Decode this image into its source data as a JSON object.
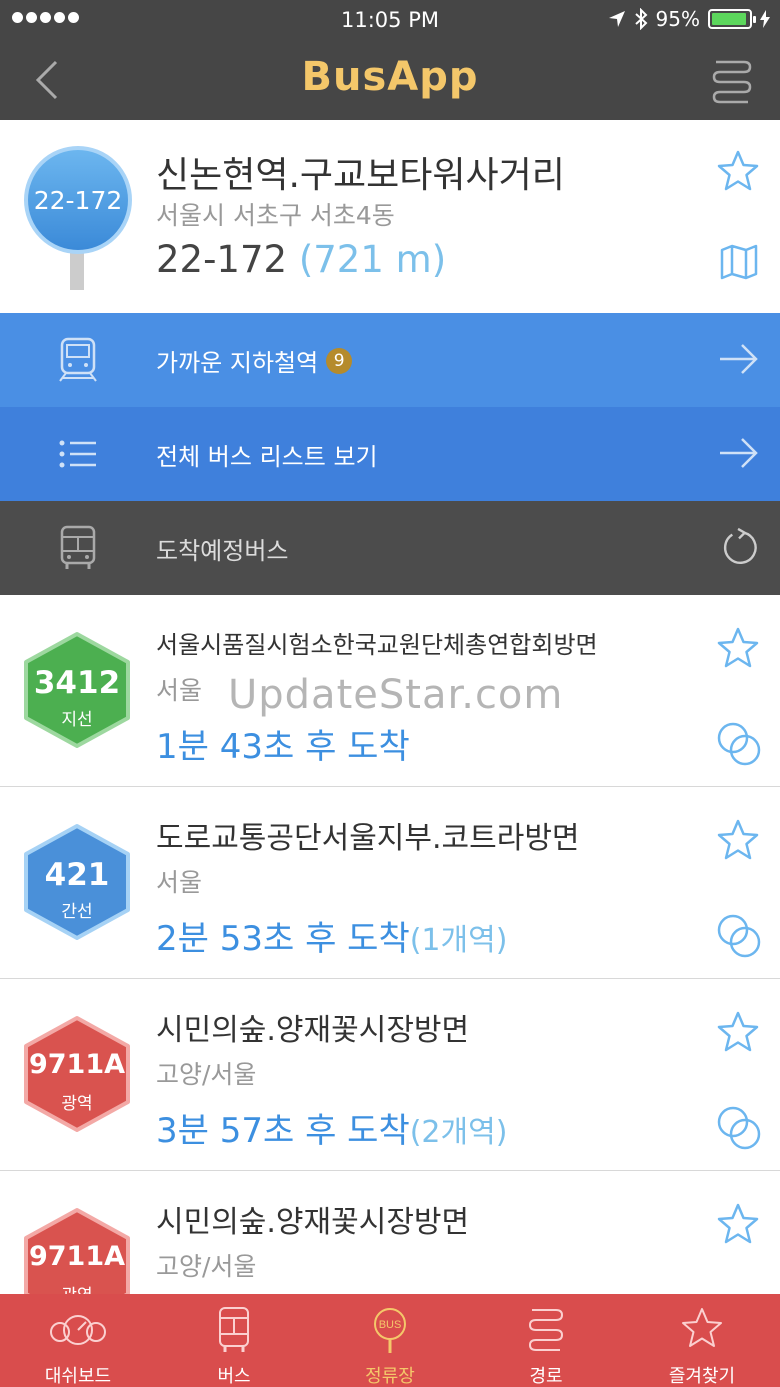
{
  "status": {
    "time": "11:05 PM",
    "battery": "95%"
  },
  "nav": {
    "title": "BusApp"
  },
  "stop": {
    "sign_label": "22-172",
    "name": "신논현역.구교보타워사거리",
    "address": "서울시 서초구 서초4동",
    "id": "22-172",
    "distance": "(721 m)"
  },
  "menu": {
    "subway_label": "가까운 지하철역",
    "subway_count": "9",
    "list_label": "전체 버스 리스트 보기",
    "arrival_label": "도착예정버스"
  },
  "buses": [
    {
      "number": "3412",
      "type": "지선",
      "dest": "서울시품질시험소한국교원단체총연합회방면",
      "region": "서울",
      "eta": "1분 43초 후 도착",
      "stops": ""
    },
    {
      "number": "421",
      "type": "간선",
      "dest": "도로교통공단서울지부.코트라방면",
      "region": "서울",
      "eta": "2분 53초 후 도착",
      "stops": "(1개역)"
    },
    {
      "number": "9711A",
      "type": "광역",
      "dest": "시민의숲.양재꽃시장방면",
      "region": "고양/서울",
      "eta": "3분 57초 후 도착",
      "stops": "(2개역)"
    },
    {
      "number": "9711A",
      "type": "광역",
      "dest": "시민의숲.양재꽃시장방면",
      "region": "고양/서울",
      "eta": "",
      "stops": ""
    }
  ],
  "watermark": "UpdateStar.com",
  "tabs": [
    {
      "label": "대쉬보드"
    },
    {
      "label": "버스"
    },
    {
      "label": "정류장",
      "icon_text": "BUS"
    },
    {
      "label": "경로"
    },
    {
      "label": "즐겨찾기"
    }
  ],
  "colors": {
    "nav": "#464646",
    "accent": "#f4c76a",
    "blue": "#4a8fe4",
    "tabbar": "#d94d4d",
    "green": "#4caf50",
    "sky": "#4a90d9",
    "red": "#d9534f"
  }
}
